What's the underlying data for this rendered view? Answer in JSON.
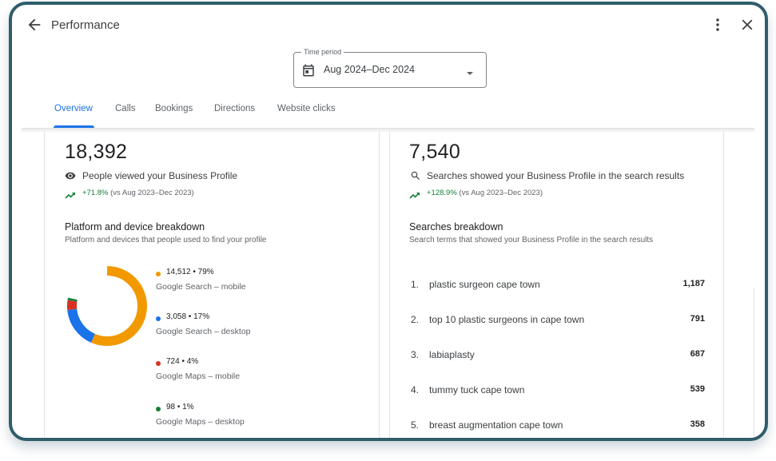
{
  "header": {
    "title": "Performance",
    "back_icon": "arrow-back-icon",
    "more_icon": "more-vert-icon",
    "close_icon": "close-icon"
  },
  "time_period": {
    "label": "Time period",
    "value": "Aug 2024–Dec 2024",
    "icon": "calendar-icon"
  },
  "tabs": [
    {
      "label": "Overview",
      "active": true
    },
    {
      "label": "Calls"
    },
    {
      "label": "Bookings"
    },
    {
      "label": "Directions"
    },
    {
      "label": "Website clicks"
    }
  ],
  "left_panel": {
    "total": "18,392",
    "label": "People viewed your Business Profile",
    "icon": "eye-icon",
    "change": "+71.8%",
    "comparison": "(vs Aug 2023–Dec 2023)",
    "section_title": "Platform and device breakdown",
    "section_subtitle": "Platform and devices that people used to find your profile",
    "breakdown": [
      {
        "value": "14,512 • 79%",
        "name": "Google Search – mobile",
        "percent": 79,
        "color": "#f29900"
      },
      {
        "value": "3,058 • 17%",
        "name": "Google Search – desktop",
        "percent": 17,
        "color": "#1a73e8"
      },
      {
        "value": "724 • 4%",
        "name": "Google Maps – mobile",
        "percent": 4,
        "color": "#d93025"
      },
      {
        "value": "98 • 1%",
        "name": "Google Maps – desktop",
        "percent": 1,
        "color": "#188038"
      }
    ]
  },
  "right_panel": {
    "total": "7,540",
    "label": "Searches showed your Business Profile in the search results",
    "icon": "search-icon",
    "change": "+128.9%",
    "comparison": "(vs Aug 2023–Dec 2023)",
    "section_title": "Searches breakdown",
    "section_subtitle": "Search terms that showed your Business Profile in the search results",
    "searches": [
      {
        "rank": "1.",
        "term": "plastic surgeon cape town",
        "count": "1,187"
      },
      {
        "rank": "2.",
        "term": "top 10 plastic surgeons in cape town",
        "count": "791"
      },
      {
        "rank": "3.",
        "term": "labiaplasty",
        "count": "687"
      },
      {
        "rank": "4.",
        "term": "tummy tuck cape town",
        "count": "539"
      },
      {
        "rank": "5.",
        "term": "breast augmentation cape town",
        "count": "358"
      }
    ]
  },
  "colors": {
    "accent": "#1a73e8",
    "positive": "#188038",
    "frame": "#2f5d6b"
  }
}
